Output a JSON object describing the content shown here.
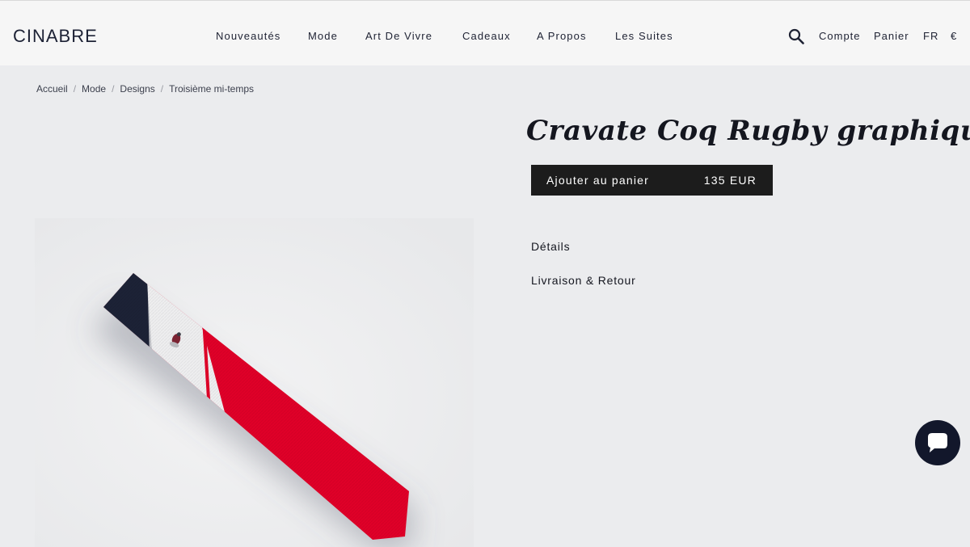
{
  "header": {
    "logo": "CINABRE",
    "nav": [
      "Nouveautés",
      "Mode",
      "Art De Vivre",
      "Cadeaux",
      "A Propos",
      "Les Suites"
    ],
    "search_icon": "search-icon",
    "account": "Compte",
    "cart": "Panier",
    "language": "FR",
    "currency": "€"
  },
  "breadcrumb": [
    "Accueil",
    "Mode",
    "Designs",
    "Troisième mi-temps"
  ],
  "product": {
    "title": "Cravate Coq Rugby graphique",
    "add_to_cart": "Ajouter au panier",
    "price": "135 EUR",
    "details": "Détails",
    "shipping": "Livraison & Retour",
    "image": "tie-image"
  },
  "chat": {
    "icon": "chat-bubble-icon"
  },
  "colors": {
    "navy": "#1c2236",
    "red": "#e00028",
    "white": "#f1f1f1",
    "button_bg": "#1c1c1c",
    "chat_bg": "#12172b"
  }
}
